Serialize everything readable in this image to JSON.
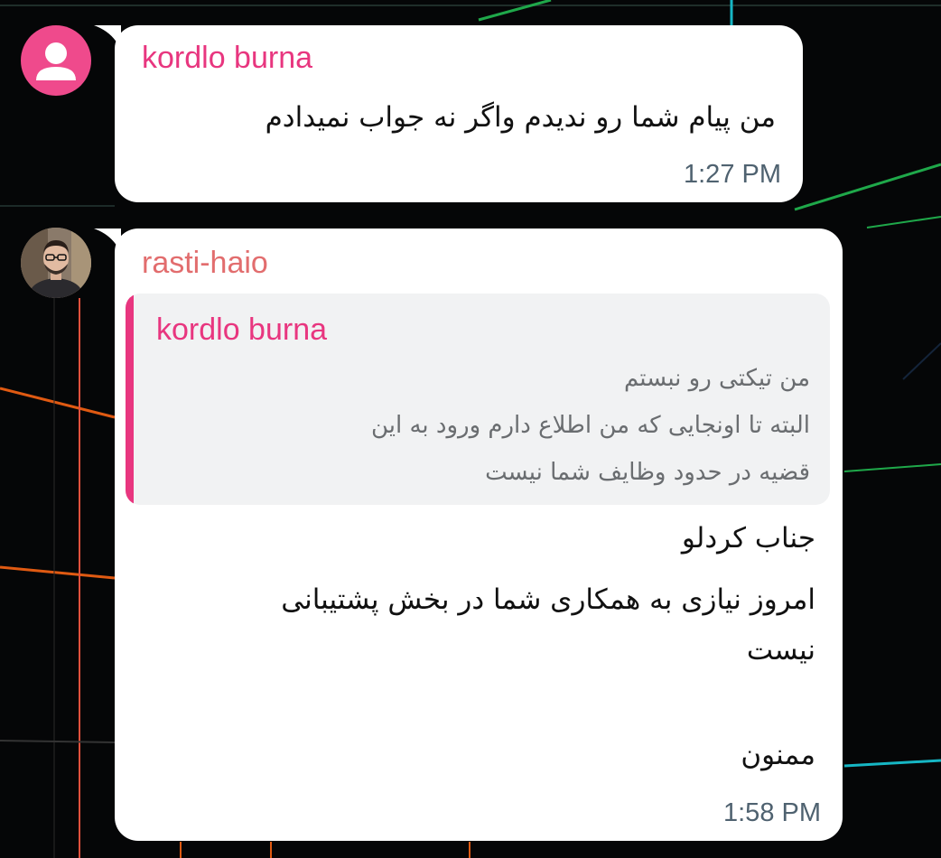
{
  "messages": [
    {
      "sender": "kordlo burna",
      "avatar": "default-user-icon",
      "text": "من پیام شما رو ندیدم واگر نه جواب نمیدادم",
      "time": "1:27 PM"
    },
    {
      "sender": "rasti-haio",
      "avatar": "profile-photo",
      "reply": {
        "sender": "kordlo burna",
        "lines": [
          "من تیکتی رو نبستم",
          "البته تا اونجایی که من اطلاع دارم ورود به این",
          "قضیه در حدود وظایف شما نیست"
        ]
      },
      "lines": [
        "جناب کردلو",
        "امروز نیازی به همکاری شما در بخش پشتیبانی",
        "نیست",
        "ممنون"
      ],
      "time": "1:58 PM"
    }
  ],
  "colors": {
    "background": "#050607",
    "bubble": "#ffffff",
    "sender_pink": "#e8367f",
    "sender_coral": "#e26d6e",
    "timestamp": "#4f6270",
    "reply_bg": "#f1f2f3"
  }
}
